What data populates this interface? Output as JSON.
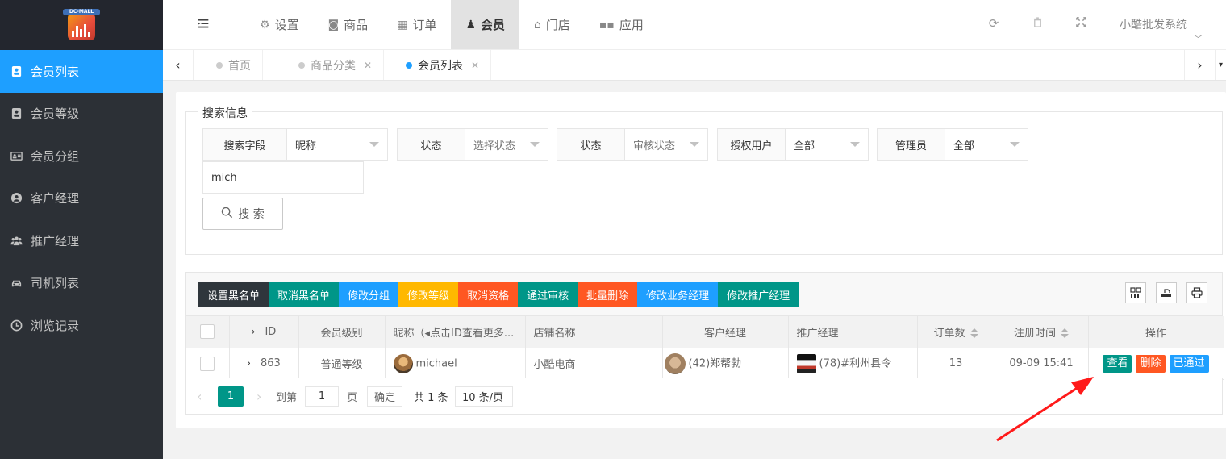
{
  "sidebar": {
    "logo_text": "DC-MALL",
    "items": [
      {
        "label": "会员列表",
        "icon": "member-card-icon",
        "active": true
      },
      {
        "label": "会员等级",
        "icon": "member-level-icon",
        "active": false
      },
      {
        "label": "会员分组",
        "icon": "member-group-icon",
        "active": false
      },
      {
        "label": "客户经理",
        "icon": "user-circle-icon",
        "active": false
      },
      {
        "label": "推广经理",
        "icon": "users-icon",
        "active": false
      },
      {
        "label": "司机列表",
        "icon": "car-icon",
        "active": false
      },
      {
        "label": "浏览记录",
        "icon": "clock-icon",
        "active": false
      }
    ]
  },
  "topnav": {
    "items": [
      {
        "label": "设置",
        "icon": "gears-icon"
      },
      {
        "label": "商品",
        "icon": "shopping-bag-icon"
      },
      {
        "label": "订单",
        "icon": "table-icon"
      },
      {
        "label": "会员",
        "icon": "user-icon"
      },
      {
        "label": "门店",
        "icon": "bank-icon"
      },
      {
        "label": "应用",
        "icon": "grid-icon"
      }
    ],
    "system_name": "小酷批发系统"
  },
  "tabs": [
    {
      "label": "首页",
      "closable": false
    },
    {
      "label": "商品分类",
      "closable": true
    },
    {
      "label": "会员列表",
      "closable": true,
      "active": true
    }
  ],
  "search": {
    "legend": "搜索信息",
    "field_label": "搜索字段",
    "field_value": "昵称",
    "status1_label": "状态",
    "status1_placeholder": "选择状态",
    "status2_label": "状态",
    "status2_placeholder": "审核状态",
    "auth_label": "授权用户",
    "auth_value": "全部",
    "admin_label": "管理员",
    "admin_value": "全部",
    "keyword": "mich",
    "button": "搜 索"
  },
  "toolbar": {
    "buttons": [
      {
        "label": "设置黑名单",
        "color": "#2f363c"
      },
      {
        "label": "取消黑名单",
        "color": "#009688"
      },
      {
        "label": "修改分组",
        "color": "#1e9fff"
      },
      {
        "label": "修改等级",
        "color": "#ffb800"
      },
      {
        "label": "取消资格",
        "color": "#ff5722"
      },
      {
        "label": "通过审核",
        "color": "#009688"
      },
      {
        "label": "批量删除",
        "color": "#ff5722"
      },
      {
        "label": "修改业务经理",
        "color": "#1e9fff"
      },
      {
        "label": "修改推广经理",
        "color": "#009688"
      }
    ]
  },
  "table": {
    "headers": {
      "id": "ID",
      "level": "会员级别",
      "nickname": "昵称（◂点击ID查看更多...",
      "shop": "店铺名称",
      "customer_manager": "客户经理",
      "promo_manager": "推广经理",
      "orders": "订单数",
      "reg_time": "注册时间",
      "actions": "操作"
    },
    "rows": [
      {
        "id": "863",
        "level": "普通等级",
        "nickname": "michael",
        "shop": "小酷电商",
        "customer_manager": "(42)郑帮勃",
        "promo_manager": "(78)#利州县令",
        "orders": "13",
        "reg_time": "09-09 15:41",
        "view": "查看",
        "delete": "删除",
        "approved": "已通过"
      }
    ]
  },
  "pager": {
    "current": "1",
    "goto_label": "到第",
    "goto_value": "1",
    "page_label": "页",
    "confirm": "确定",
    "total": "共 1 条",
    "per_page": "10 条/页"
  }
}
